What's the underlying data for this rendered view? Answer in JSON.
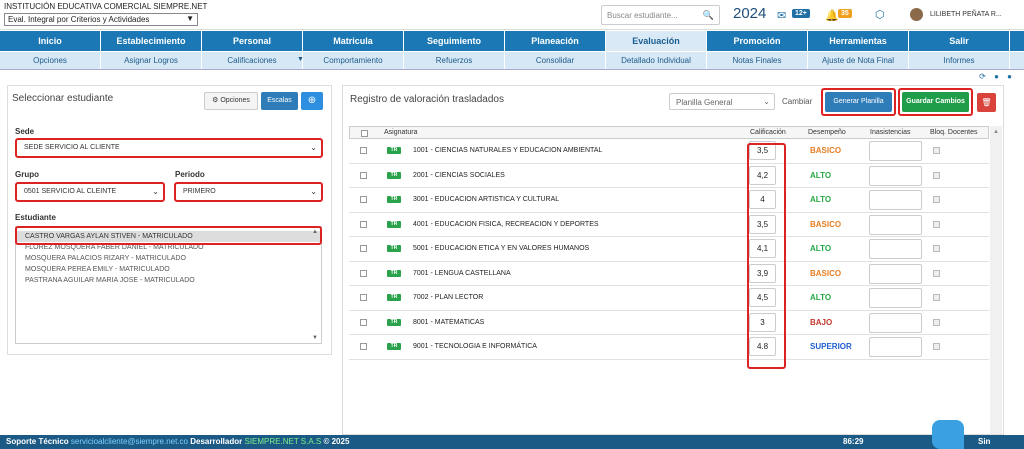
{
  "header": {
    "institution": "INSTITUCIÓN EDUCATIVA COMERCIAL SIEMPRE.NET",
    "eval_mode": "Eval. Integral por Criterios y Actividades",
    "search_placeholder": "Buscar estudiante...",
    "year": "2024",
    "messages_count": "12+",
    "notifications_count": "35",
    "user_name": "LILIBETH PEÑATA R..."
  },
  "nav_primary": [
    {
      "label": "Inicio"
    },
    {
      "label": "Establecimiento"
    },
    {
      "label": "Personal"
    },
    {
      "label": "Matricula"
    },
    {
      "label": "Seguimiento"
    },
    {
      "label": "Planeación"
    },
    {
      "label": "Evaluación",
      "active": true
    },
    {
      "label": "Promoción"
    },
    {
      "label": "Herramientas"
    },
    {
      "label": "Salir"
    }
  ],
  "nav_secondary": [
    {
      "label": "Opciones"
    },
    {
      "label": "Asignar Logros"
    },
    {
      "label": "Calificaciones"
    },
    {
      "label": "Comportamiento"
    },
    {
      "label": "Refuerzos"
    },
    {
      "label": "Consolidar"
    },
    {
      "label": "Detallado Individual"
    },
    {
      "label": "Notas Finales"
    },
    {
      "label": "Ajuste de Nota Final"
    },
    {
      "label": "Informes"
    }
  ],
  "left": {
    "title": "Seleccionar estudiante",
    "opciones_label": "Opciones",
    "escalas_label": "Escalas",
    "sede_label": "Sede",
    "sede_value": "SEDE SERVICIO AL CLIENTE",
    "grupo_label": "Grupo",
    "grupo_value": "0501 SERVICIO AL CLEINTE",
    "periodo_label": "Periodo",
    "periodo_value": "PRIMERO",
    "estudiante_label": "Estudiante",
    "students": [
      "CASTRO VARGAS AYLAN STIVEN - MATRICULADO",
      "FLOREZ MOSQUERA FABER DANIEL - MATRICULADO",
      "MOSQUERA PALACIOS RIZARY - MATRICULADO",
      "MOSQUERA PEREA EMILY - MATRICULADO",
      "PASTRANA AGUILAR MARIA JOSE - MATRICULADO"
    ]
  },
  "right": {
    "title": "Registro de valoración trasladados",
    "planilla_value": "Planilla General",
    "cambiar_label": "Cambiar",
    "generar_label": "Generar Planilla",
    "guardar_label": "Guardar Cambios",
    "columns": {
      "asignatura": "Asignatura",
      "calificacion": "Calificación",
      "desempeno": "Desempeño",
      "inasistencias": "Inasistencias",
      "bloq": "Bloq. Docentes"
    },
    "tr_label": "TR",
    "rows": [
      {
        "asignatura": "1001 - CIENCIAS NATURALES Y EDUCACION AMBIENTAL",
        "calificacion": "3,5",
        "desempeno": "BASICO",
        "color": "#e67e22"
      },
      {
        "asignatura": "2001 - CIENCIAS SOCIALES",
        "calificacion": "4,2",
        "desempeno": "ALTO",
        "color": "#27a844"
      },
      {
        "asignatura": "3001 - EDUCACION ARTISTICA Y CULTURAL",
        "calificacion": "4",
        "desempeno": "ALTO",
        "color": "#27a844"
      },
      {
        "asignatura": "4001 - EDUCACION FISICA, RECREACION Y DEPORTES",
        "calificacion": "3,5",
        "desempeno": "BASICO",
        "color": "#e67e22"
      },
      {
        "asignatura": "5001 - EDUCACION ETICA Y EN VALORES HUMANOS",
        "calificacion": "4,1",
        "desempeno": "ALTO",
        "color": "#27a844"
      },
      {
        "asignatura": "7001 - LENGUA CASTELLANA",
        "calificacion": "3,9",
        "desempeno": "BASICO",
        "color": "#e67e22"
      },
      {
        "asignatura": "7002 - PLAN LECTOR",
        "calificacion": "4,5",
        "desempeno": "ALTO",
        "color": "#27a844"
      },
      {
        "asignatura": "8001 - MATEMATICAS",
        "calificacion": "3",
        "desempeno": "BAJO",
        "color": "#c0392b"
      },
      {
        "asignatura": "9001 - TECNOLOGIA E INFORMÁTICA",
        "calificacion": "4.8",
        "desempeno": "SUPERIOR",
        "color": "#1f5fd1"
      }
    ]
  },
  "footer": {
    "soporte_label": "Soporte Técnico",
    "soporte_email": "servicioalcliente@siempre.net.co",
    "dev_label": "Desarrollador",
    "dev_name": "SIEMPRE.NET S.A.S",
    "copyright": "© 2025",
    "counter": "86:29",
    "chat_label": "Sin"
  }
}
